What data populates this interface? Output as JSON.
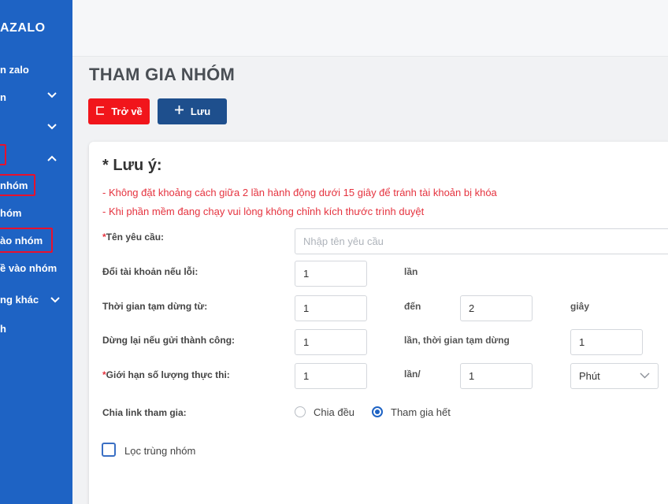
{
  "sidebar": {
    "brand": "AZALO",
    "items": [
      {
        "label": "n zalo"
      },
      {
        "label": "n",
        "chevron": "⌄"
      },
      {
        "label": "",
        "chevron": "⌄"
      },
      {
        "label": "",
        "chevron": "⌃"
      },
      {
        "label": "nhóm"
      },
      {
        "label": "hóm"
      },
      {
        "label": "ào nhóm"
      },
      {
        "label": "ề vào nhóm"
      },
      {
        "label": "ng khác",
        "chevron": "⌄"
      },
      {
        "label": "h"
      }
    ]
  },
  "page": {
    "title": "THAM GIA NHÓM",
    "back_label": "Trở về",
    "back_icon": "exit-icon",
    "save_label": "Lưu",
    "save_icon": "plus-icon"
  },
  "note": {
    "title": "* Lưu ý:",
    "lines": [
      "- Không đặt khoảng cách giữa 2 lần hành động dưới 15 giây để tránh tài khoản bị khóa",
      "- Khi phần mềm đang chạy vui lòng không chỉnh kích thước trình duyệt"
    ]
  },
  "form": {
    "request_name": {
      "label": "Tên yêu cầu:",
      "required": "*",
      "placeholder": "Nhập tên yêu cầu",
      "value": ""
    },
    "switch_account": {
      "label": "Đổi tài khoản nếu lỗi:",
      "value": "1",
      "unit": "lần"
    },
    "pause": {
      "label": "Thời gian tạm dừng từ:",
      "from": "1",
      "to_label": "đến",
      "to": "2",
      "unit": "giây"
    },
    "stop_success": {
      "label": "Dừng lại nếu gửi thành công:",
      "value": "1",
      "unit": "lần, thời gian tạm dừng",
      "pause_value": "1"
    },
    "limit": {
      "label": "Giới hạn số lượng thực thi:",
      "required": "*",
      "value": "1",
      "unit": "lần/",
      "per_value": "1",
      "period": "Phút"
    },
    "share_link": {
      "label": "Chia link tham gia:",
      "options": [
        "Chia đều",
        "Tham gia hết"
      ],
      "selected": "Tham gia hết"
    },
    "dedupe": {
      "label": "Lọc trùng nhóm",
      "checked": false
    }
  },
  "colors": {
    "sidebar": "#1e63c4",
    "back_button": "#f1151b",
    "save_button": "#1e4f8d",
    "warning_text": "#e5333f",
    "highlight_box": "#e8112d"
  }
}
